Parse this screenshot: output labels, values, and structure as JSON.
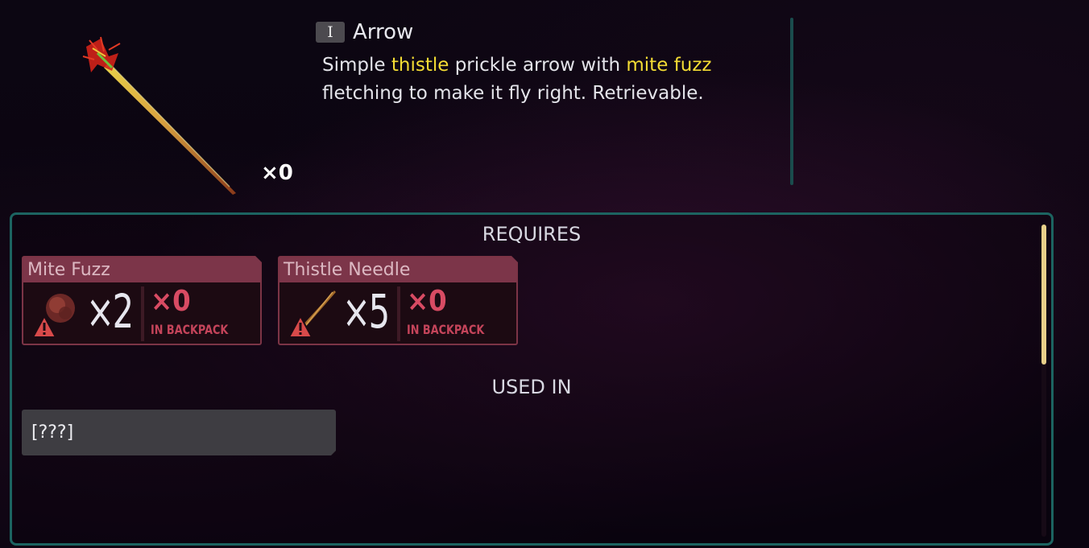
{
  "item": {
    "tier": "I",
    "name": "Arrow",
    "owned_count": "×0",
    "description": {
      "part1": "Simple ",
      "hl1": "thistle",
      "part2": " prickle arrow with ",
      "hl2": "mite fuzz",
      "part3": " fletching to make it fly right. Retrievable."
    },
    "icon": "arrow-icon"
  },
  "requires": {
    "title": "REQUIRES",
    "ingredients": [
      {
        "name": "Mite Fuzz",
        "icon": "mite-fuzz-icon",
        "needed": "×2",
        "have": "×0",
        "have_label": "IN BACKPACK",
        "warning_icon": "warning-icon"
      },
      {
        "name": "Thistle Needle",
        "icon": "thistle-needle-icon",
        "needed": "×5",
        "have": "×0",
        "have_label": "IN BACKPACK",
        "warning_icon": "warning-icon"
      }
    ]
  },
  "used_in": {
    "title": "USED IN",
    "items": [
      "[???]"
    ]
  },
  "colors": {
    "highlight": "#f4dc34",
    "panel_border": "#1c6461",
    "card_header": "#7c3549",
    "missing_red": "#d84b63",
    "scroll_thumb": "#e8d08a"
  }
}
